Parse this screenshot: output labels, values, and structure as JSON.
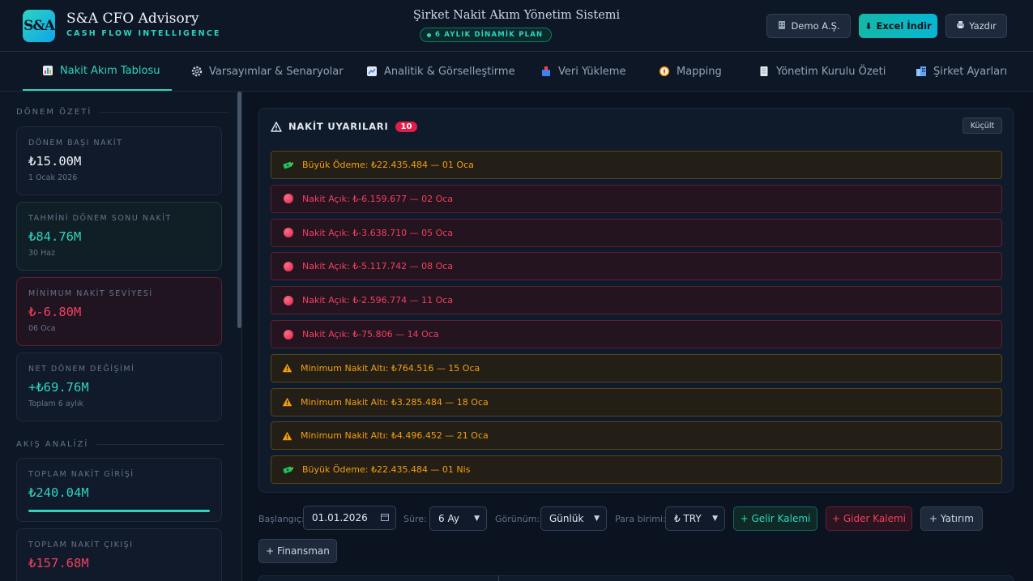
{
  "header": {
    "logo_text": "S&A",
    "brand_name": "S&A CFO Advisory",
    "brand_tagline": "CASH FLOW INTELLIGENCE",
    "app_title": "Şirket Nakit Akım Yönetim Sistemi",
    "plan_badge": "6 AYLIK DİNAMİK PLAN",
    "company_button": "Demo A.Ş.",
    "excel_button": "Excel İndir",
    "print_button": "Yazdır"
  },
  "nav": {
    "tabs": [
      {
        "label": "Nakit Akım Tablosu",
        "icon": "bar-chart-icon",
        "active": true
      },
      {
        "label": "Varsayımlar & Senaryolar",
        "icon": "gear-icon"
      },
      {
        "label": "Analitik & Görselleştirme",
        "icon": "line-chart-icon"
      },
      {
        "label": "Veri Yükleme",
        "icon": "inbox-icon"
      },
      {
        "label": "Mapping",
        "icon": "compass-icon"
      },
      {
        "label": "Yönetim Kurulu Özeti",
        "icon": "document-icon"
      },
      {
        "label": "Şirket Ayarları",
        "icon": "building-icon"
      }
    ]
  },
  "sidebar": {
    "period_section": "DÖNEM ÖZETİ",
    "cards": [
      {
        "label": "DÖNEM BAŞI NAKİT",
        "value": "₺15.00M",
        "sub": "1 Ocak 2026"
      },
      {
        "label": "TAHMİNİ DÖNEM SONU NAKİT",
        "value": "₺84.76M",
        "sub": "30 Haz"
      },
      {
        "label": "MİNİMUM NAKİT SEVİYESİ",
        "value": "₺-6.80M",
        "sub": "06 Oca"
      },
      {
        "label": "NET DÖNEM DEĞİŞİMİ",
        "value": "+₺69.76M",
        "sub": "Toplam 6 aylık"
      }
    ],
    "flow_section": "AKIŞ ANALİZİ",
    "flow_cards": [
      {
        "label": "TOPLAM NAKİT GİRİŞİ",
        "value": "₺240.04M",
        "progress": 1.0
      },
      {
        "label": "TOPLAM NAKİT ÇIKIŞI",
        "value": "₺157.68M"
      }
    ]
  },
  "alerts": {
    "title": "NAKİT UYARILARI",
    "count": "10",
    "collapse_button": "Küçült",
    "items": [
      {
        "type": "payment",
        "icon": "money-icon",
        "text": "Büyük Ödeme: ₺22.435.484 — 01 Oca"
      },
      {
        "type": "deficit",
        "icon": "red-dot-icon",
        "text": "Nakit Açık: ₺-6.159.677 — 02 Oca"
      },
      {
        "type": "deficit",
        "icon": "red-dot-icon",
        "text": "Nakit Açık: ₺-3.638.710 — 05 Oca"
      },
      {
        "type": "deficit",
        "icon": "red-dot-icon",
        "text": "Nakit Açık: ₺-5.117.742 — 08 Oca"
      },
      {
        "type": "deficit",
        "icon": "red-dot-icon",
        "text": "Nakit Açık: ₺-2.596.774 — 11 Oca"
      },
      {
        "type": "deficit",
        "icon": "red-dot-icon",
        "text": "Nakit Açık: ₺-75.806 — 14 Oca"
      },
      {
        "type": "warning",
        "icon": "warning-icon",
        "text": "Minimum Nakit Altı: ₺764.516 — 15 Oca"
      },
      {
        "type": "warning",
        "icon": "warning-icon",
        "text": "Minimum Nakit Altı: ₺3.285.484 — 18 Oca"
      },
      {
        "type": "warning",
        "icon": "warning-icon",
        "text": "Minimum Nakit Altı: ₺4.496.452 — 21 Oca"
      },
      {
        "type": "payment",
        "icon": "money-icon",
        "text": "Büyük Ödeme: ₺22.435.484 — 01 Nis"
      }
    ]
  },
  "toolbar": {
    "start_label": "Başlangıç:",
    "start_value": "01.01.2026",
    "duration_label": "Süre:",
    "duration_value": "6 Ay",
    "view_label": "Görünüm:",
    "view_value": "Günlük",
    "currency_label": "Para birimi:",
    "currency_value": "₺ TRY",
    "add_income": "+ Gelir Kalemi",
    "add_expense": "+ Gider Kalemi",
    "add_investment": "+ Yatırım",
    "add_financing": "+ Finansman"
  },
  "colors": {
    "accent": "#2dd4bf",
    "danger": "#f43f5e",
    "warning": "#f59e0b",
    "background": "#0b1220"
  }
}
